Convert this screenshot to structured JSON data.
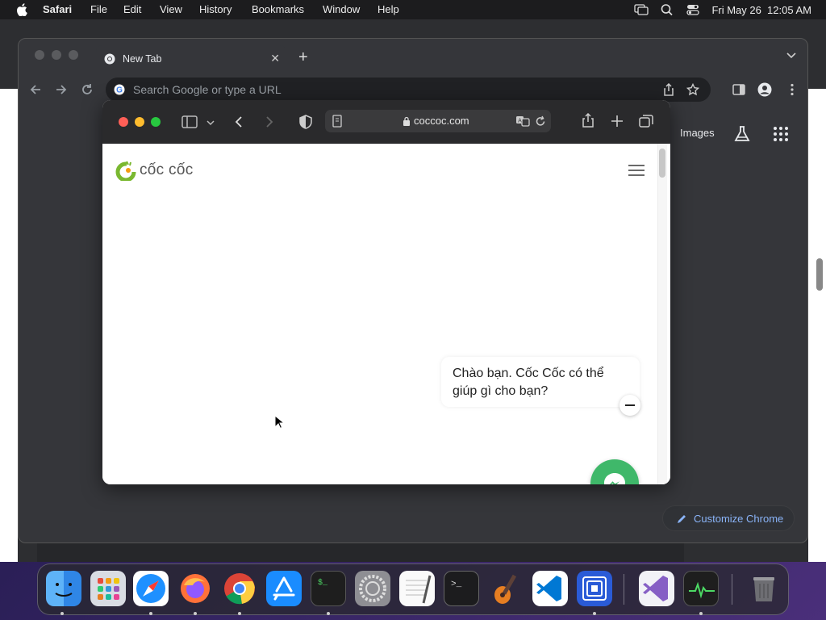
{
  "menubar": {
    "app": "Safari",
    "items": [
      "File",
      "Edit",
      "View",
      "History",
      "Bookmarks",
      "Window",
      "Help"
    ],
    "clock": "Fri May 26  12:05 AM"
  },
  "chrome": {
    "tab_title": "New Tab",
    "omnibox_placeholder": "Search Google or type a URL",
    "images_link": "Images",
    "customize_label": "Customize Chrome"
  },
  "safari": {
    "url": "coccoc.com"
  },
  "page": {
    "logo_text": "cốc cốc",
    "chat_greeting_line1": "Chào bạn. Cốc Cốc có thể",
    "chat_greeting_line2": "giúp gì cho bạn?"
  },
  "dock": {
    "apps": [
      "Finder",
      "Launchpad",
      "Safari",
      "Firefox",
      "Chrome",
      "App Store",
      "Terminal",
      "System Settings",
      "TextEdit",
      "Script Editor",
      "GarageBand",
      "VS Code",
      "Screen Sharing",
      "Visual Studio",
      "Activity Monitor",
      "Trash"
    ]
  },
  "colors": {
    "chrome_bg": "#35363a",
    "safari_toolbar": "#2a2a2c",
    "messenger_green": "#3fb86a",
    "link_blue": "#8ab4f8"
  }
}
